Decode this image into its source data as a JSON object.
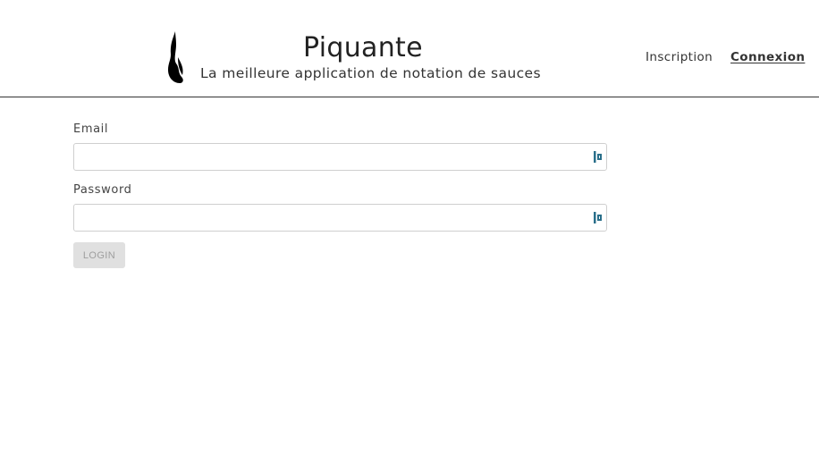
{
  "header": {
    "title": "Piquante",
    "subtitle": "La meilleure application de notation de sauces",
    "logo_icon": "flame-icon"
  },
  "nav": {
    "signup_label": "Inscription",
    "login_label": "Connexion"
  },
  "form": {
    "email": {
      "label": "Email",
      "value": "",
      "placeholder": ""
    },
    "password": {
      "label": "Password",
      "value": "",
      "placeholder": ""
    },
    "field_icon": "password-manager-icon",
    "submit_label": "LOGIN"
  },
  "colors": {
    "text": "#333333",
    "field_icon": "#2a6f8a",
    "button_disabled_bg": "#e0e0e0",
    "button_disabled_text": "#9e9e9e"
  }
}
